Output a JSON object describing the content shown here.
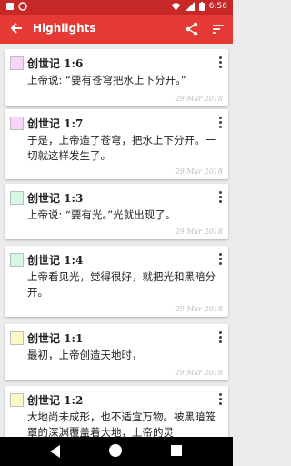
{
  "status_bar": {
    "time": "6:56"
  },
  "app_bar": {
    "title": "Highlights"
  },
  "colors": {
    "app_bar": "#e53935",
    "status_bar": "#c62828",
    "background": "#ebebeb"
  },
  "highlights": [
    {
      "reference": "创世记 1:6",
      "text": "上帝说: “要有苍穹把水上下分开。”",
      "date": "29 Mar 2018",
      "color": "#f8d4f8"
    },
    {
      "reference": "创世记 1:7",
      "text": "于是，上帝造了苍穹，把水上下分开。一切就这样发生了。",
      "date": "29 Mar 2018",
      "color": "#f8d4f8"
    },
    {
      "reference": "创世记 1:3",
      "text": "上帝说: “要有光。”光就出现了。",
      "date": "29 Mar 2018",
      "color": "#d4f8e4"
    },
    {
      "reference": "创世记 1:4",
      "text": "上帝看见光，觉得很好，就把光和黑暗分开。",
      "date": "29 Mar 2018",
      "color": "#d4f8e4"
    },
    {
      "reference": "创世记 1:1",
      "text": "最初，上帝创造天地时，",
      "date": "29 Mar 2018",
      "color": "#fbf8c4"
    },
    {
      "reference": "创世记 1:2",
      "text": "大地尚未成形，也不适宜万物。被黑暗笼罩的深渊覆盖着大地，上帝的灵",
      "date": "",
      "color": "#fbf8c4"
    }
  ]
}
